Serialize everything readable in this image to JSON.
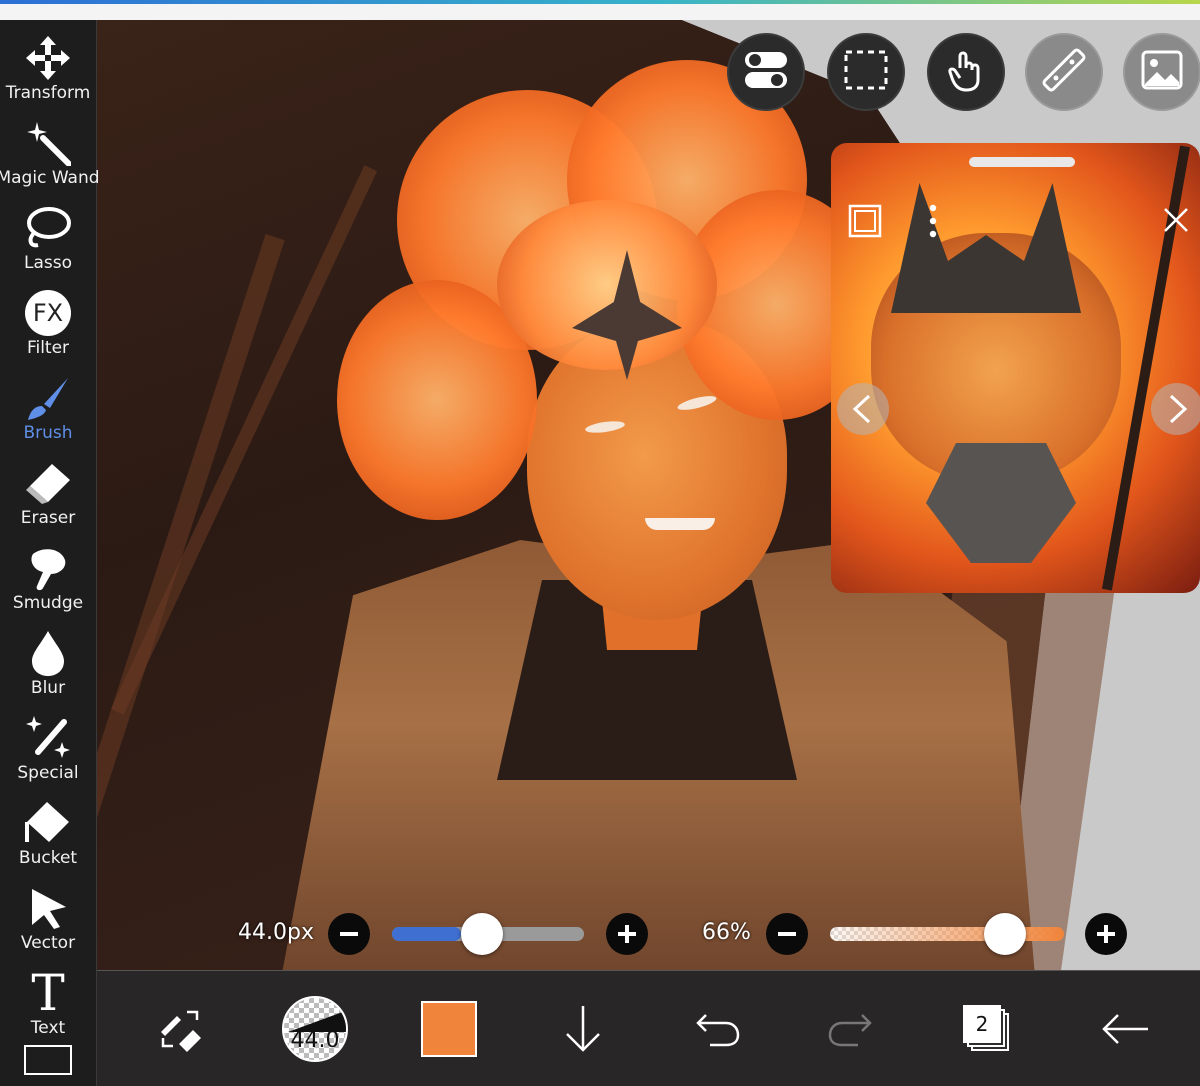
{
  "toolbar": {
    "tools": [
      {
        "label": "Transform",
        "icon": "move-arrows-icon"
      },
      {
        "label": "Magic Wand",
        "icon": "magic-wand-icon"
      },
      {
        "label": "Lasso",
        "icon": "lasso-icon"
      },
      {
        "label": "Filter",
        "icon": "fx-filter-icon",
        "glyph": "FX"
      },
      {
        "label": "Brush",
        "icon": "brush-icon",
        "active": true
      },
      {
        "label": "Eraser",
        "icon": "eraser-icon"
      },
      {
        "label": "Smudge",
        "icon": "smudge-finger-icon"
      },
      {
        "label": "Blur",
        "icon": "droplet-icon"
      },
      {
        "label": "Special",
        "icon": "sparkle-wand-icon"
      },
      {
        "label": "Bucket",
        "icon": "paint-bucket-icon"
      },
      {
        "label": "Vector",
        "icon": "cursor-arrow-icon"
      },
      {
        "label": "Text",
        "icon": "text-t-icon",
        "glyph": "T"
      }
    ]
  },
  "top_buttons": [
    {
      "icon": "toggle-switches-icon"
    },
    {
      "icon": "selection-rect-icon"
    },
    {
      "icon": "touch-hand-icon"
    },
    {
      "icon": "ruler-icon"
    },
    {
      "icon": "image-reference-icon"
    }
  ],
  "sliders": {
    "brush_size_label": "44.0px",
    "brush_size_fraction": 0.36,
    "opacity_label": "66%",
    "opacity_fraction": 0.66
  },
  "bottom": {
    "brush_preview_value": "44.0",
    "layer_count": "2",
    "current_color": "#f0843a"
  },
  "colors": {
    "accent": "#5f8fe6",
    "toolbar_bg": "#1d1d1d"
  }
}
